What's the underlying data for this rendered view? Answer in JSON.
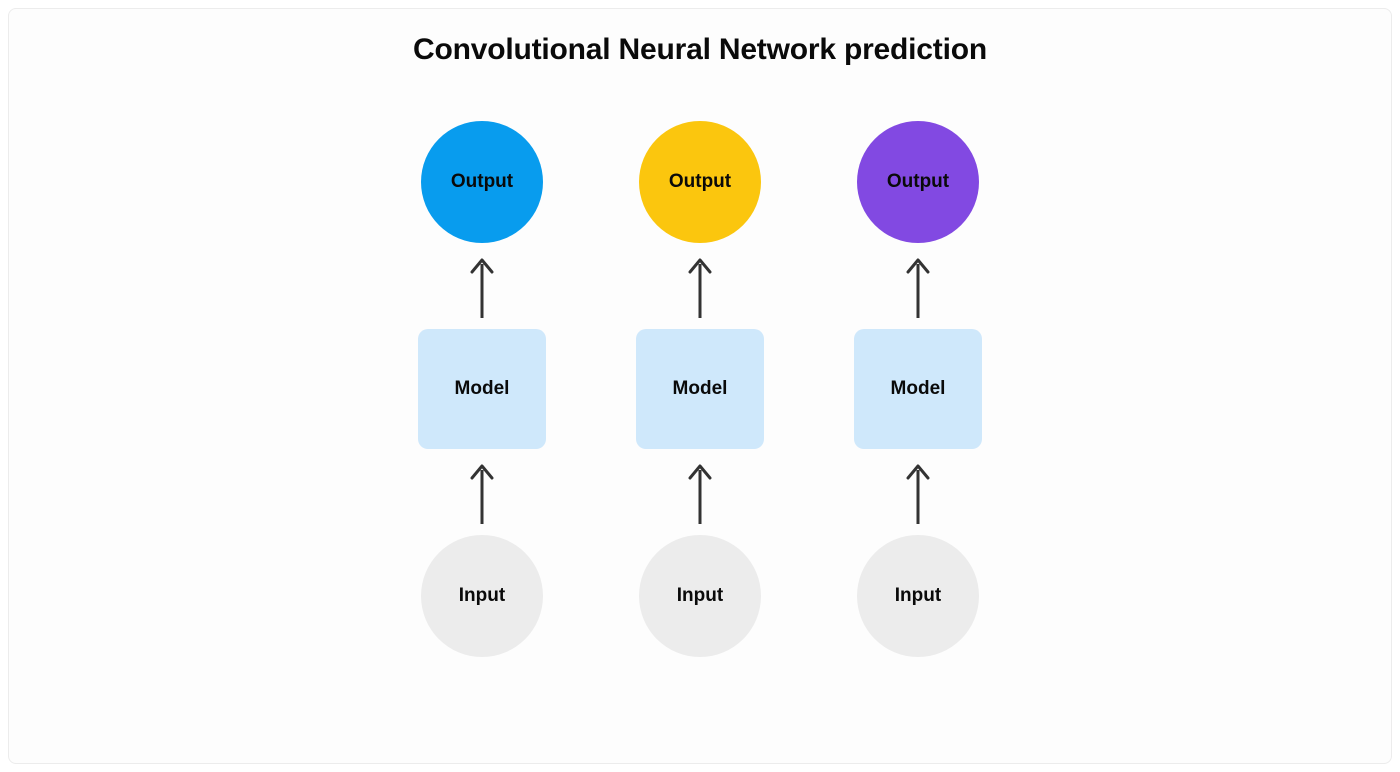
{
  "title": "Convolutional Neural Network prediction",
  "columns": [
    {
      "output_label": "Output",
      "output_color": "#089cee",
      "model_label": "Model",
      "input_label": "Input"
    },
    {
      "output_label": "Output",
      "output_color": "#fbc60e",
      "model_label": "Model",
      "input_label": "Input"
    },
    {
      "output_label": "Output",
      "output_color": "#8249e2",
      "model_label": "Model",
      "input_label": "Input"
    }
  ],
  "colors": {
    "model_box": "#cfe8fb",
    "input_circle": "#ececec",
    "arrow": "#333333"
  }
}
